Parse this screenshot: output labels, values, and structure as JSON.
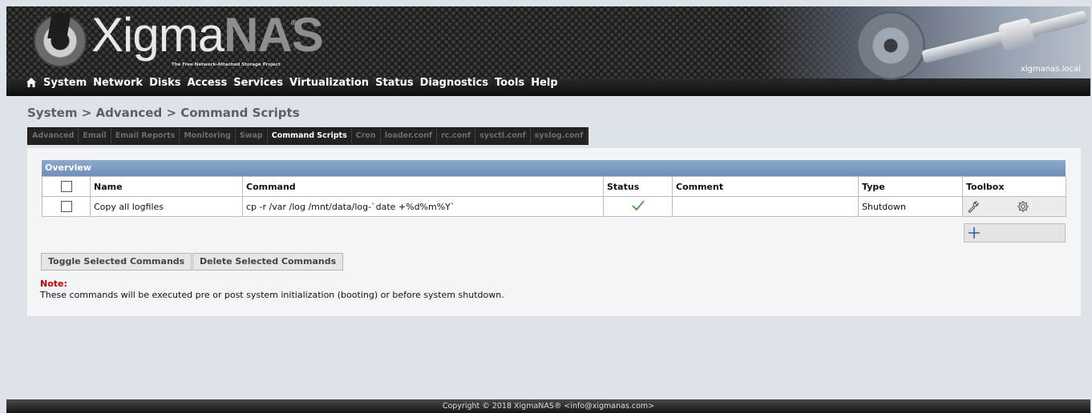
{
  "header": {
    "logo_text": "Xigma",
    "logo_text_suffix": "NAS",
    "logo_registered": "®",
    "tagline": "The Free Network-Attached Storage Project",
    "hostname": "xigmanas.local"
  },
  "nav": {
    "home_icon": "home-icon",
    "items": [
      "System",
      "Network",
      "Disks",
      "Access",
      "Services",
      "Virtualization",
      "Status",
      "Diagnostics",
      "Tools",
      "Help"
    ]
  },
  "breadcrumb": "System > Advanced > Command Scripts",
  "tabs": {
    "items": [
      "Advanced",
      "Email",
      "Email Reports",
      "Monitoring",
      "Swap",
      "Command Scripts",
      "Cron",
      "loader.conf",
      "rc.conf",
      "sysctl.conf",
      "syslog.conf"
    ],
    "active": "Command Scripts"
  },
  "overview": {
    "title": "Overview",
    "columns": [
      "",
      "Name",
      "Command",
      "Status",
      "Comment",
      "Type",
      "Toolbox"
    ],
    "rows": [
      {
        "checked": false,
        "name": "Copy all logfiles",
        "command": "cp -r /var /log /mnt/data/log-`date +%d%m%Y`",
        "status_icon": "checkmark-icon",
        "comment": "",
        "type": "Shutdown",
        "tools": [
          "wrench-icon",
          "gear-icon"
        ]
      }
    ],
    "add_icon": "plus-icon"
  },
  "buttons": {
    "toggle": "Toggle Selected Commands",
    "delete": "Delete Selected Commands"
  },
  "note": {
    "label": "Note:",
    "text": "These commands will be executed pre or post system initialization (booting) or before system shutdown."
  },
  "footer": "Copyright © 2018 XigmaNAS® <info@xigmanas.com>",
  "colors": {
    "accent": "#7b99c3",
    "note": "#c40000",
    "status_ok": "#2e9a2e",
    "add": "#2f5fb0"
  }
}
